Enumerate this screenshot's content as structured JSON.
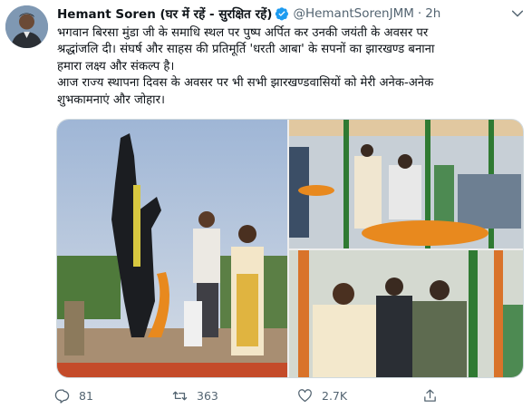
{
  "tweet": {
    "author_name": "Hemant Soren (घर में रहें - सुरक्षित रहें)",
    "handle": "@HemantSorenJMM",
    "separator": "·",
    "time": "2h",
    "text_lines": [
      "भगवान बिरसा मुंडा जी के समाधि स्थल पर पुष्प अर्पित कर उनकी जयंती के अवसर पर",
      "श्रद्धांजलि दी। संघर्ष और साहस की प्रतिमूर्ति 'धरती आबा' के सपनों का झारखण्ड बनाना",
      "हमारा लक्ष्य और संकल्प है।",
      "आज राज्य स्थापना दिवस के अवसर पर भी सभी झारखण्डवासियों को मेरी अनेक-अनेक",
      "शुभकामनाएं और जोहार।"
    ]
  },
  "actions": {
    "reply_count": "81",
    "retweet_count": "363",
    "like_count": "2.7K"
  },
  "icons": {
    "verified": "verified-badge-icon",
    "caret": "chevron-down-icon",
    "reply": "reply-icon",
    "retweet": "retweet-icon",
    "like": "heart-icon",
    "share": "share-icon"
  },
  "colors": {
    "text": "#0f1419",
    "secondary": "#536471",
    "verified": "#1d9bf0",
    "marigold": "#e8891e"
  }
}
